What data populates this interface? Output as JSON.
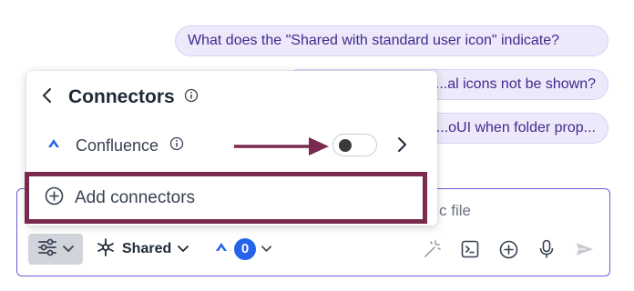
{
  "suggestions": [
    "What does the \"Shared with standard user icon\" indicate?",
    "...al icons not be shown?",
    "...oUI when folder prop..."
  ],
  "composer": {
    "placeholder": "c file",
    "shared_label": "Shared",
    "connector_count": "0"
  },
  "popup": {
    "title": "Connectors",
    "connector_name": "Confluence",
    "connector_enabled": false,
    "add_label": "Add connectors"
  },
  "colors": {
    "chip_bg": "#ede9fb",
    "chip_text": "#3f2a8c",
    "annotation": "#7a2a4e",
    "badge": "#2563eb"
  }
}
